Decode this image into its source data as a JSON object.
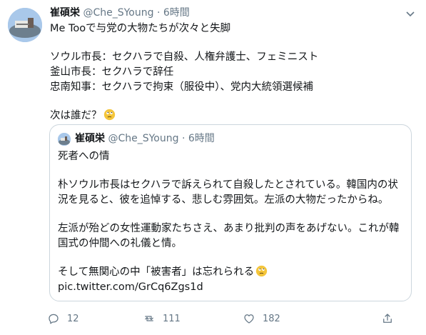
{
  "author": {
    "name": "崔碩栄",
    "handle": "@Che_SYoung",
    "separator": "·",
    "time": "6時間"
  },
  "tweet": {
    "line1": "Me Tooで与党の大物たちが次々と失脚",
    "line2": "ソウル市長：セクハラで自殺、人権弁護士、フェミニスト",
    "line3": "釜山市長：セクハラで辞任",
    "line4": "忠南知事：セクハラで拘束（服役中）、党内大統領選候補",
    "line5": "次は誰だ？"
  },
  "quoted": {
    "author": {
      "name": "崔碩栄",
      "handle": "@Che_SYoung",
      "separator": "·",
      "time": "6時間"
    },
    "title": "死者への情",
    "para1": "朴ソウル市長はセクハラで訴えられて自殺したとされている。韓国内の状況を見ると、彼を追悼する、悲しむ雰囲気。左派の大物だったからね。",
    "para2": "左派が殆どの女性運動家たちさえ、あまり批判の声をあげない。これが韓国式の仲間への礼儀と情。",
    "para3": "そして無関心の中「被害者」は忘れられる",
    "link": "pic.twitter.com/GrCq6Zgs1d"
  },
  "actions": {
    "reply_count": "12",
    "retweet_count": "111",
    "like_count": "182"
  },
  "icons": {
    "reply": "reply-icon",
    "retweet": "retweet-icon",
    "like": "heart-icon",
    "share": "share-icon",
    "caret": "chevron-down-icon",
    "emoji": "face-with-rolling-eyes-emoji"
  },
  "colors": {
    "text": "#14171a",
    "secondary": "#657786",
    "border": "#ccd6dd",
    "emoji": "#f4c53a"
  }
}
